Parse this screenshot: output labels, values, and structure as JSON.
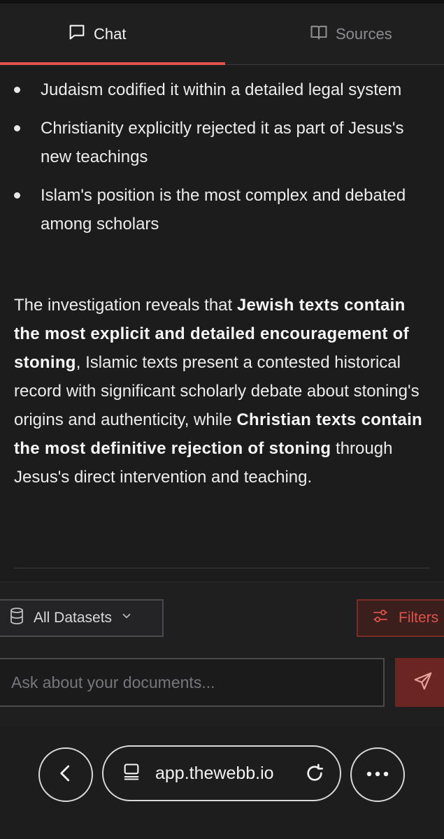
{
  "tabs": [
    {
      "label": "Chat",
      "icon": "chat-icon",
      "active": true
    },
    {
      "label": "Sources",
      "icon": "book-icon",
      "active": false
    }
  ],
  "message": {
    "bullets": [
      "Judaism codified it within a detailed legal system",
      "Christianity explicitly rejected it as part of Jesus's new teachings",
      "Islam's position is the most complex and debated among scholars"
    ],
    "summary": {
      "p1": "The investigation reveals that ",
      "b1": "Jewish texts contain the most explicit and detailed encouragement of stoning",
      "p2": ", Islamic texts present a contested historical record with significant scholarly debate about stoning's origins and authenticity, while ",
      "b2": "Christian texts contain the most definitive rejection of stoning",
      "p3": " through Jesus's direct intervention and teaching."
    }
  },
  "controls": {
    "dataset_label": "All Datasets",
    "filters_label": "Filters",
    "input_placeholder": "Ask about your documents..."
  },
  "browser": {
    "url": "app.thewebb.io"
  },
  "colors": {
    "accent": "#e0524a",
    "background": "#1c1c1d",
    "text": "#ececec",
    "muted": "#8d8d91"
  }
}
